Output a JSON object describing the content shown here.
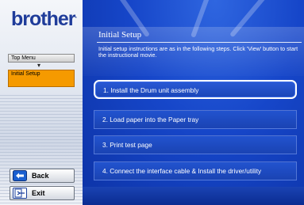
{
  "brand": {
    "logo_text": "brother",
    "mark": "."
  },
  "sidebar": {
    "menu_top_label": "Top Menu",
    "menu_arrow": "▾",
    "current_label": "Initial Setup"
  },
  "nav": {
    "back_label": "Back",
    "exit_label": "Exit"
  },
  "main": {
    "title": "Initial Setup",
    "intro": "Initial setup instructions are as in the following steps. Click 'View' button to start the instructional movie.",
    "steps": [
      {
        "label": "1. Install the Drum unit assembly"
      },
      {
        "label": "2. Load paper into the Paper tray"
      },
      {
        "label": "3. Print test page"
      },
      {
        "label": "4. Connect the interface cable & Install the driver/utility"
      }
    ]
  },
  "colors": {
    "brand_blue": "#1f3c9a",
    "highlight_orange": "#f59a00",
    "panel_blue": "#1646c9"
  },
  "icons": {
    "back": "back-arrow-icon",
    "exit": "exit-door-icon"
  }
}
